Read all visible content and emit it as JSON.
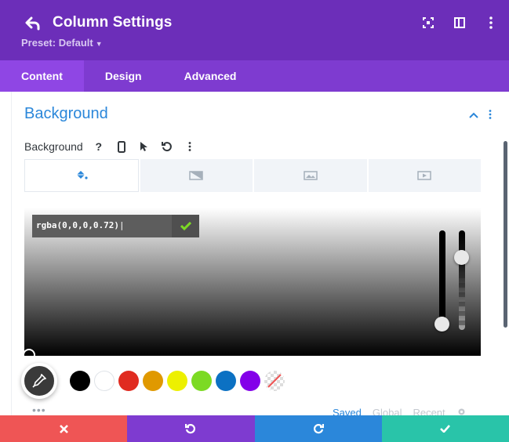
{
  "header": {
    "title": "Column Settings",
    "preset": "Preset: Default",
    "bg_color": "#6c2eb9"
  },
  "tabs": [
    {
      "label": "Content",
      "active": true
    },
    {
      "label": "Design",
      "active": false
    },
    {
      "label": "Advanced",
      "active": false
    }
  ],
  "section": {
    "title": "Background",
    "option_label": "Background",
    "help": "?"
  },
  "background_types": [
    "color",
    "gradient",
    "image",
    "video"
  ],
  "picker": {
    "value": "rgba(0,0,0,0.72)",
    "alpha": 0.72
  },
  "swatches": [
    "#000000",
    "#ffffff",
    "#e02b20",
    "#e09900",
    "#edf000",
    "#7cda24",
    "#0c71c3",
    "#8300e9",
    "none"
  ],
  "palette_tabs": {
    "saved": "Saved",
    "global": "Global",
    "recent": "Recent"
  },
  "footer_colors": {
    "cancel": "#ef5555",
    "undo": "#7e3bd0",
    "redo": "#2b87da",
    "save": "#29c4a9"
  }
}
